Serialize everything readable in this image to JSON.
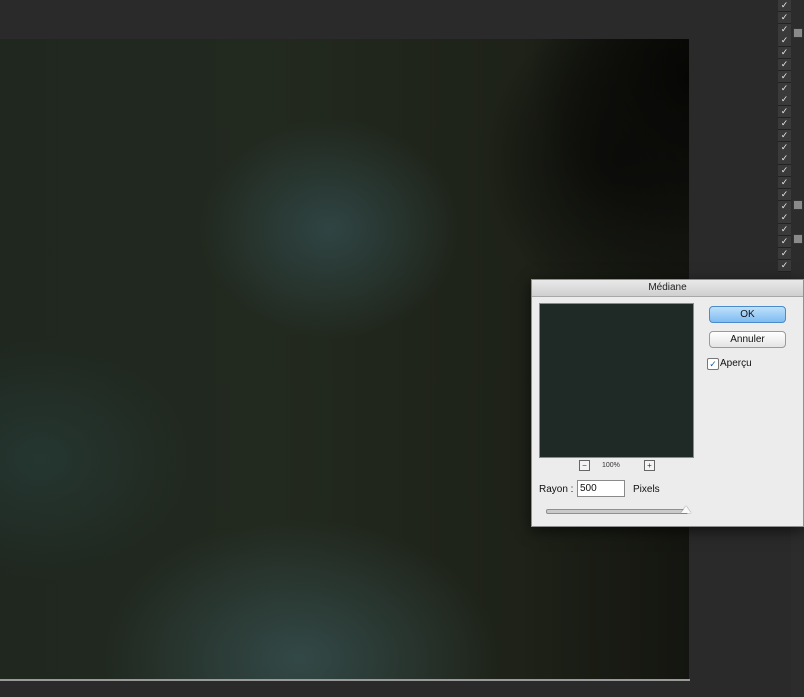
{
  "dialog": {
    "title": "Médiane",
    "ok_label": "OK",
    "cancel_label": "Annuler",
    "preview_checkbox_label": "Aperçu",
    "preview_checked": true,
    "zoom_out_symbol": "−",
    "zoom_in_symbol": "+",
    "zoom_level": "100%",
    "radius_label": "Rayon :",
    "radius_value": "500",
    "radius_units": "Pixels",
    "slider_level": 1.0
  },
  "layers_panel": {
    "checkmark_glyph": "✓",
    "visible_rows": 23
  },
  "colors": {
    "ok_accent": "#7fbcf1",
    "preview_fill": "#1f2925",
    "workspace_bg": "#2a2a2a"
  }
}
